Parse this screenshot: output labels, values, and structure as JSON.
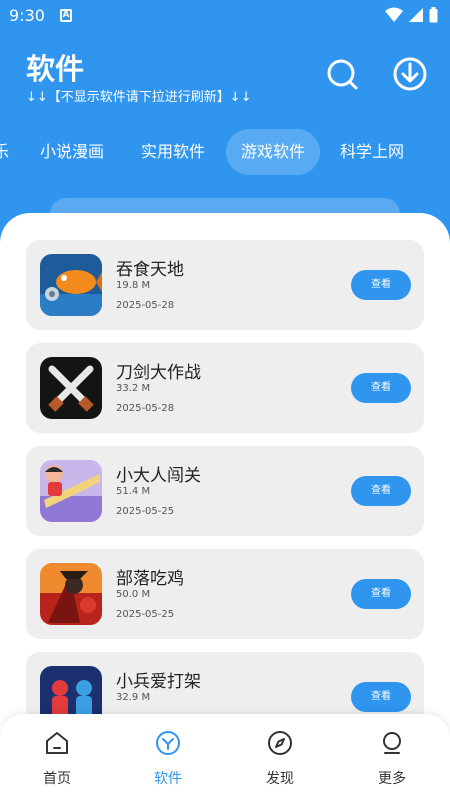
{
  "status_bar": {
    "time": "9:30",
    "notification_letter": "A"
  },
  "header": {
    "title": "软件",
    "subtitle": "↓↓【不显示软件请下拉进行刷新】↓↓"
  },
  "tabs": [
    {
      "label": "乐",
      "active": false
    },
    {
      "label": "小说漫画",
      "active": false
    },
    {
      "label": "实用软件",
      "active": false
    },
    {
      "label": "游戏软件",
      "active": true
    },
    {
      "label": "科学上网",
      "active": false
    }
  ],
  "apps": [
    {
      "name": "吞食天地",
      "size": "19.8 M",
      "date": "2025-05-28",
      "button": "查看",
      "icon": "fish-game-icon"
    },
    {
      "name": "刀剑大作战",
      "size": "33.2 M",
      "date": "2025-05-28",
      "button": "查看",
      "icon": "crossed-swords-icon"
    },
    {
      "name": "小大人闯关",
      "size": "51.4 M",
      "date": "2025-05-25",
      "button": "查看",
      "icon": "runner-game-icon"
    },
    {
      "name": "部落吃鸡",
      "size": "50.0 M",
      "date": "2025-05-25",
      "button": "查看",
      "icon": "tribe-battle-icon"
    },
    {
      "name": "小兵爱打架",
      "size": "32.9 M",
      "date": "",
      "button": "查看",
      "icon": "fighters-game-icon"
    }
  ],
  "bottom_nav": [
    {
      "label": "首页",
      "icon": "home-icon",
      "active": false
    },
    {
      "label": "软件",
      "icon": "apps-icon",
      "active": true
    },
    {
      "label": "发现",
      "icon": "compass-icon",
      "active": false
    },
    {
      "label": "更多",
      "icon": "more-icon",
      "active": false
    }
  ],
  "colors": {
    "accent": "#2f95ef",
    "card_bg": "#eeeeee",
    "text": "#222222"
  }
}
